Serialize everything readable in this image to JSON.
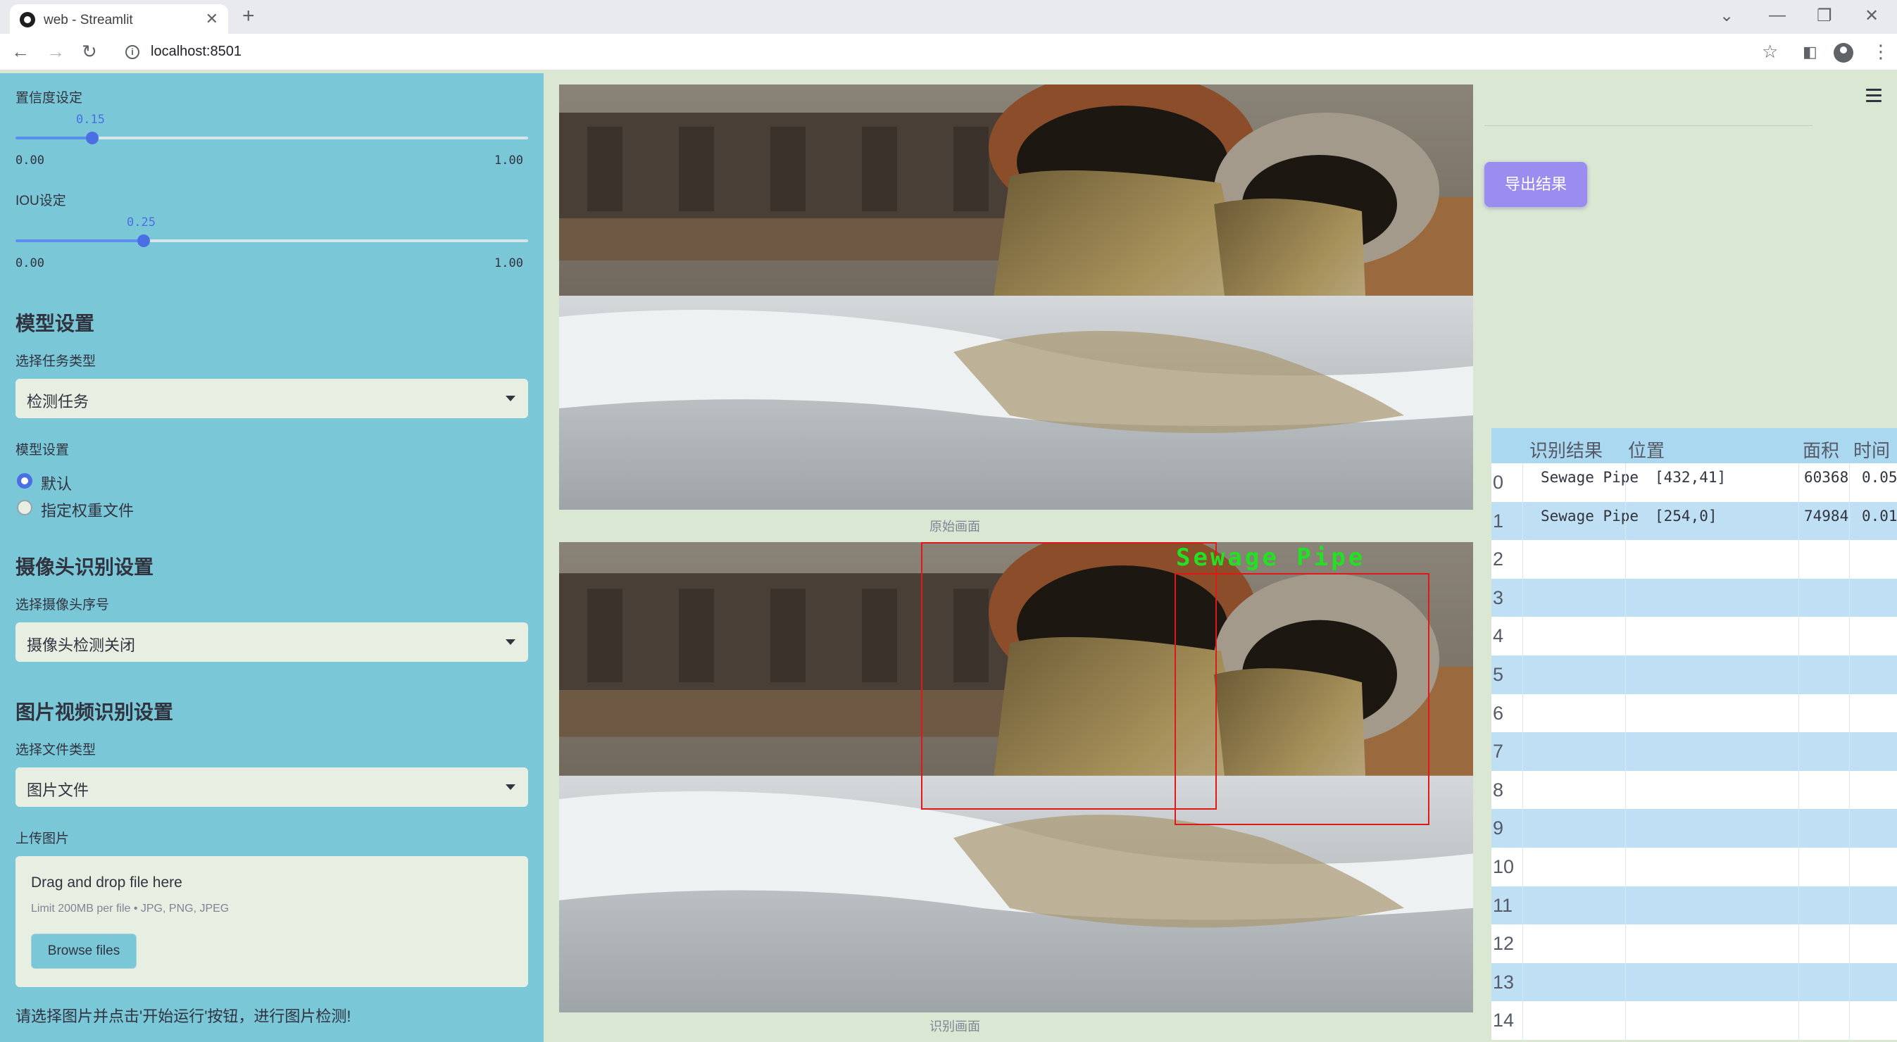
{
  "browser": {
    "tab_title": "web - Streamlit",
    "tab_close": "✕",
    "new_tab": "+",
    "url": "localhost:8501",
    "minimize": "—",
    "restore": "❐",
    "close": "✕",
    "tab_list": "⌄"
  },
  "sidebar": {
    "confidence": {
      "label": "置信度设定",
      "value": "0.15",
      "fraction": 0.15,
      "min": "0.00",
      "max": "1.00"
    },
    "iou": {
      "label": "IOU设定",
      "value": "0.25",
      "fraction": 0.25,
      "min": "0.00",
      "max": "1.00"
    },
    "model_heading": "模型设置",
    "task_label": "选择任务类型",
    "task_value": "检测任务",
    "model_label": "模型设置",
    "model_options": [
      "默认",
      "指定权重文件"
    ],
    "model_selected": 0,
    "camera_heading": "摄像头识别设置",
    "camera_label": "选择摄像头序号",
    "camera_value": "摄像头检测关闭",
    "media_heading": "图片视频识别设置",
    "file_type_label": "选择文件类型",
    "file_type_value": "图片文件",
    "upload_label": "上传图片",
    "upload_title": "Drag and drop file here",
    "upload_limit": "Limit 200MB per file • JPG, PNG, JPEG",
    "browse_label": "Browse files",
    "hint": "请选择图片并点击'开始运行'按钮，进行图片检测!"
  },
  "main": {
    "original_caption": "原始画面",
    "result_caption": "识别画面",
    "detection_label": "Sewage Pipe"
  },
  "right": {
    "export_label": "导出结果",
    "table": {
      "columns": [
        "识别结果",
        "位置",
        "面积",
        "时间"
      ],
      "row_indices": [
        "0",
        "1",
        "2",
        "3",
        "4",
        "5",
        "6",
        "7",
        "8",
        "9",
        "10",
        "11",
        "12",
        "13",
        "14"
      ],
      "rows": [
        {
          "result": "Sewage Pipe",
          "position": "[432,41]",
          "area": "60368",
          "time": "0.05"
        },
        {
          "result": "Sewage Pipe",
          "position": "[254,0]",
          "area": "74984",
          "time": "0.01"
        }
      ]
    }
  },
  "colors": {
    "sidebar_bg": "#7ac7d8",
    "main_bg": "#d9e7d3",
    "accent": "#4a6fe3",
    "export_button": "#9b8cf0",
    "box_color": "#e01818",
    "label_color": "#22e022"
  },
  "icons": [
    "streamlit-favicon",
    "back-arrow-icon",
    "forward-arrow-icon",
    "reload-icon",
    "info-icon",
    "star-icon",
    "sidepanel-icon",
    "profile-icon",
    "kebab-menu-icon",
    "hamburger-menu-icon",
    "chevron-down-icon"
  ]
}
